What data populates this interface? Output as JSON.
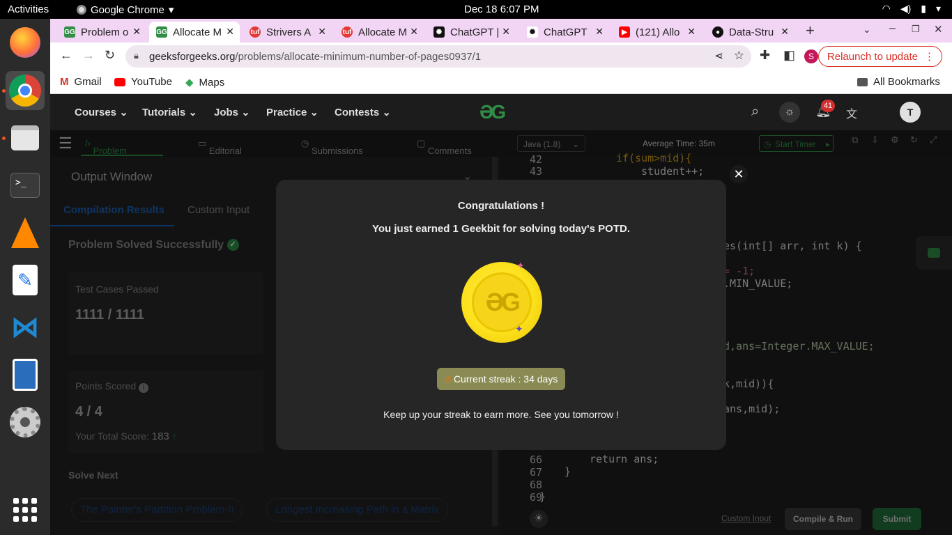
{
  "system_bar": {
    "activities": "Activities",
    "app_name": "Google Chrome",
    "clock": "Dec 18  6:07 PM"
  },
  "tabs": [
    {
      "title": "Problem o",
      "favicon": "gfg"
    },
    {
      "title": "Allocate M",
      "favicon": "gfg",
      "active": true
    },
    {
      "title": "Strivers A",
      "favicon": "tuf"
    },
    {
      "title": "Allocate M",
      "favicon": "tuf"
    },
    {
      "title": "ChatGPT |",
      "favicon": "chatgpt"
    },
    {
      "title": "ChatGPT",
      "favicon": "chatgpt"
    },
    {
      "title": "(121) Allo",
      "favicon": "youtube"
    },
    {
      "title": "Data-Stru",
      "favicon": "github"
    }
  ],
  "address_bar": {
    "domain": "geeksforgeeks.org",
    "path": "/problems/allocate-minimum-number-of-pages0937/1"
  },
  "relaunch_label": "Relaunch to update",
  "profile_initial": "S",
  "bookmarks": {
    "items": [
      "Gmail",
      "YouTube",
      "Maps"
    ],
    "all": "All Bookmarks"
  },
  "gfg_nav": {
    "items": [
      "Courses",
      "Tutorials",
      "Jobs",
      "Practice",
      "Contests"
    ],
    "notif_count": "41",
    "user_initial": "T"
  },
  "problem_tabs": [
    "Problem",
    "Editorial",
    "Submissions",
    "Comments"
  ],
  "output": {
    "title": "Output Window",
    "subtabs": [
      "Compilation Results",
      "Custom Input"
    ],
    "status": "Problem Solved Successfully",
    "test_label": "Test Cases Passed",
    "test_value": "1111 / 1111",
    "points_label": "Points Scored",
    "points_value": "4 / 4",
    "total_label": "Your Total Score:",
    "total_value": "183",
    "solve_next": "Solve Next",
    "next_links": [
      "The Painter's Partition Problem-II",
      "Longest Increasing Path in a Matrix"
    ]
  },
  "editor": {
    "language": "Java (1.8)",
    "avg_time": "Average Time: 35m",
    "timer": "Start Timer",
    "lines_top": [
      {
        "n": "42",
        "code": "if(sum>mid){"
      },
      {
        "n": "43",
        "code": "student++;"
      }
    ],
    "fragments": [
      "es(int[] arr, int k) {",
      "= -1;",
      ".MIN_VALUE;",
      "d,ans=Integer.MAX_VALUE;",
      "k,mid)){",
      "ans,mid);"
    ],
    "lines_bottom": [
      {
        "n": "66",
        "code": "return ans;"
      },
      {
        "n": "67",
        "code": "}"
      },
      {
        "n": "68",
        "code": ""
      },
      {
        "n": "69",
        "code": "}"
      }
    ],
    "custom_input": "Custom Input",
    "compile_run": "Compile & Run",
    "submit": "Submit"
  },
  "modal": {
    "title": "Congratulations !",
    "subtitle": "You just earned 1 Geekbit for solving today's POTD.",
    "streak": "Current streak : 34 days",
    "footer": "Keep up your streak to earn more. See you tomorrow !"
  },
  "colors": {
    "gfg_green": "#2f8d46",
    "accent_link": "#1a5fb4",
    "tab_strip": "#f2d4f4",
    "relaunch_red": "#d93025",
    "submit_green": "#1f6d3a"
  }
}
